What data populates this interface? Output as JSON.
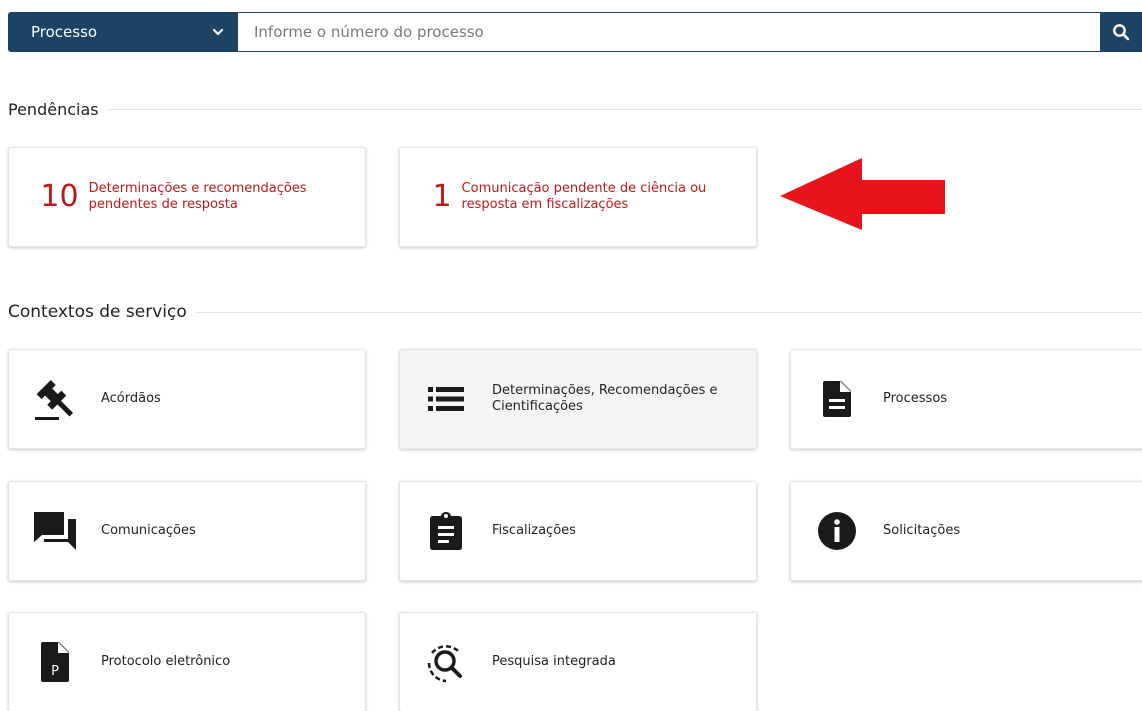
{
  "search": {
    "select_label": "Processo",
    "placeholder": "Informe o número do processo"
  },
  "sections": {
    "pending_title": "Pendências",
    "services_title": "Contextos de serviço"
  },
  "pending": [
    {
      "count": "10",
      "label": "Determinações e recomendações pendentes de resposta"
    },
    {
      "count": "1",
      "label": "Comunicação pendente de ciência ou resposta em fiscalizações"
    }
  ],
  "services": [
    {
      "label": "Acórdãos",
      "icon": "gavel-icon"
    },
    {
      "label": "Determinações, Recomendações e Cientificações",
      "icon": "list-icon"
    },
    {
      "label": "Processos",
      "icon": "document-icon"
    },
    {
      "label": "Comunicações",
      "icon": "chat-icon"
    },
    {
      "label": "Fiscalizações",
      "icon": "clipboard-icon"
    },
    {
      "label": "Solicitações",
      "icon": "info-icon"
    },
    {
      "label": "Protocolo eletrônico",
      "icon": "protocol-document-icon"
    },
    {
      "label": "Pesquisa integrada",
      "icon": "integrated-search-icon"
    }
  ],
  "colors": {
    "header_bar": "#1c4565",
    "pending_text": "#b71c1c",
    "arrow": "#e8141b"
  }
}
